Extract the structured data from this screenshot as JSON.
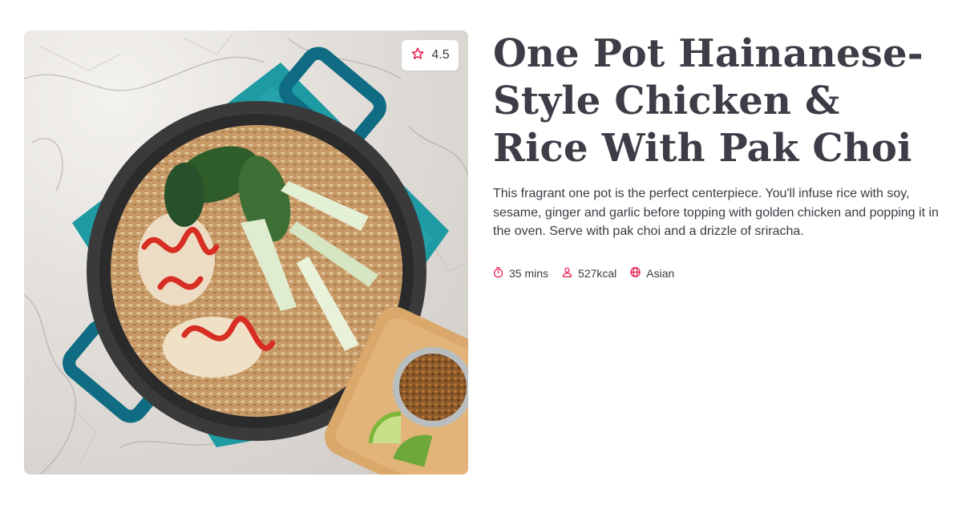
{
  "recipe": {
    "title": "One Pot Hainanese-Style Chicken & Rice With Pak Choi",
    "description": "This fragrant one pot is the perfect centerpiece. You'll infuse rice with soy, sesame, ginger and garlic before topping with golden chicken and popping it in the oven. Serve with pak choi and a drizzle of sriracha.",
    "rating": "4.5",
    "meta": {
      "time": "35 mins",
      "calories": "527kcal",
      "cuisine": "Asian"
    }
  },
  "icons": {
    "rating": "star-icon",
    "time": "timer-icon",
    "calories": "person-icon",
    "cuisine": "globe-icon"
  },
  "colors": {
    "accent": "#e8174a",
    "text": "#3b3b44"
  }
}
